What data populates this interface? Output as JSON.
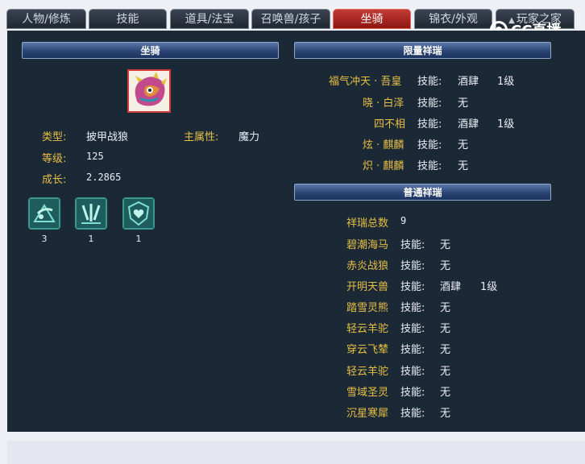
{
  "tabs": [
    {
      "label": "人物/修炼"
    },
    {
      "label": "技能"
    },
    {
      "label": "道具/法宝"
    },
    {
      "label": "召唤兽/孩子"
    },
    {
      "label": "坐骑",
      "active": true
    },
    {
      "label": "锦衣/外观"
    },
    {
      "label": "玩家之家"
    }
  ],
  "logo": {
    "text": "CC直播"
  },
  "mount": {
    "section_title": "坐骑",
    "type_label": "类型:",
    "type_value": "披甲战狼",
    "attr_label": "主属性:",
    "attr_value": "魔力",
    "level_label": "等级:",
    "level_value": "125",
    "growth_label": "成长:",
    "growth_value": "2.2865",
    "skills": [
      {
        "icon": "wing-skill-icon",
        "count": "3"
      },
      {
        "icon": "claw-skill-icon",
        "count": "1"
      },
      {
        "icon": "heart-shield-skill-icon",
        "count": "1"
      }
    ]
  },
  "limited": {
    "section_title": "限量祥瑞",
    "items": [
      {
        "name": "福气冲天 · 吾皇",
        "skill_label": "技能:",
        "skill": "酒肆",
        "level": "1级"
      },
      {
        "name": "晓 · 白泽",
        "skill_label": "技能:",
        "skill": "无",
        "level": ""
      },
      {
        "name": "四不相",
        "skill_label": "技能:",
        "skill": "酒肆",
        "level": "1级"
      },
      {
        "name": "炫 · 麒麟",
        "skill_label": "技能:",
        "skill": "无",
        "level": ""
      },
      {
        "name": "炽 · 麒麟",
        "skill_label": "技能:",
        "skill": "无",
        "level": ""
      }
    ]
  },
  "normal": {
    "section_title": "普通祥瑞",
    "total_label": "祥瑞总数",
    "total_value": "9",
    "items": [
      {
        "name": "碧潮海马",
        "skill_label": "技能:",
        "skill": "无",
        "level": ""
      },
      {
        "name": "赤炎战狼",
        "skill_label": "技能:",
        "skill": "无",
        "level": ""
      },
      {
        "name": "开明天兽",
        "skill_label": "技能:",
        "skill": "酒肆",
        "level": "1级"
      },
      {
        "name": "踏雪灵熊",
        "skill_label": "技能:",
        "skill": "无",
        "level": ""
      },
      {
        "name": "轻云羊驼",
        "skill_label": "技能:",
        "skill": "无",
        "level": ""
      },
      {
        "name": "穿云飞辇",
        "skill_label": "技能:",
        "skill": "无",
        "level": ""
      },
      {
        "name": "轻云羊驼",
        "skill_label": "技能:",
        "skill": "无",
        "level": ""
      },
      {
        "name": "雪域圣灵",
        "skill_label": "技能:",
        "skill": "无",
        "level": ""
      },
      {
        "name": "沉星寒犀",
        "skill_label": "技能:",
        "skill": "无",
        "level": ""
      }
    ]
  }
}
